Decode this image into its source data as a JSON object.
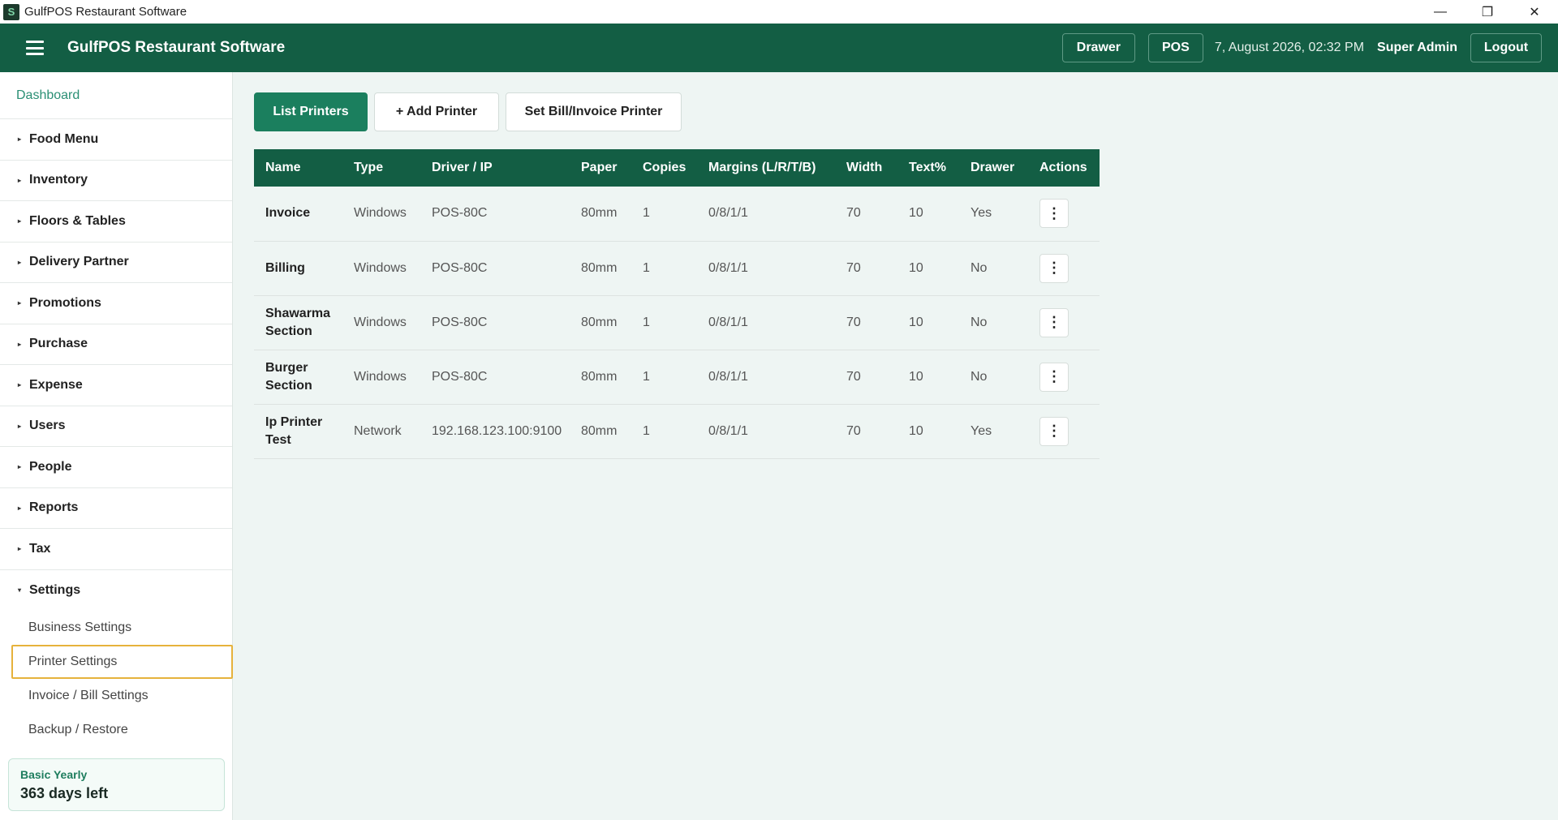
{
  "window": {
    "title": "GulfPOS Restaurant Software",
    "app_icon": "S",
    "controls": [
      "—",
      "❐",
      "✕"
    ]
  },
  "header": {
    "brand": "GulfPOS Restaurant Software",
    "drawer_label": "Drawer",
    "pos_label": "POS",
    "datetime": "7, August 2026, 02:32 PM",
    "user": "Super Admin",
    "logout_label": "Logout"
  },
  "sidebar": {
    "dashboard": "Dashboard",
    "items": [
      {
        "label": "Food Menu"
      },
      {
        "label": "Inventory"
      },
      {
        "label": "Floors & Tables"
      },
      {
        "label": "Delivery Partner"
      },
      {
        "label": "Promotions"
      },
      {
        "label": "Purchase"
      },
      {
        "label": "Expense"
      },
      {
        "label": "Users"
      },
      {
        "label": "People"
      },
      {
        "label": "Reports"
      },
      {
        "label": "Tax"
      },
      {
        "label": "Settings"
      }
    ],
    "settings_sub": [
      {
        "label": "Business Settings"
      },
      {
        "label": "Printer Settings"
      },
      {
        "label": "Invoice / Bill Settings"
      },
      {
        "label": "Backup / Restore"
      }
    ],
    "plan": {
      "name": "Basic Yearly",
      "days_left": "363 days left"
    }
  },
  "tabs": {
    "list": "List Printers",
    "add": "+ Add Printer",
    "set_bill": "Set Bill/Invoice Printer"
  },
  "table": {
    "headers": [
      "Name",
      "Type",
      "Driver / IP",
      "Paper",
      "Copies",
      "Margins (L/R/T/B)",
      "Width",
      "Text%",
      "Drawer",
      "Actions"
    ],
    "rows": [
      {
        "name": "Invoice",
        "type": "Windows",
        "driver": "POS-80C",
        "paper": "80mm",
        "copies": "1",
        "margins": "0/8/1/1",
        "width": "70",
        "text": "10",
        "drawer": "Yes"
      },
      {
        "name": "Billing",
        "type": "Windows",
        "driver": "POS-80C",
        "paper": "80mm",
        "copies": "1",
        "margins": "0/8/1/1",
        "width": "70",
        "text": "10",
        "drawer": "No"
      },
      {
        "name": "Shawarma Section",
        "type": "Windows",
        "driver": "POS-80C",
        "paper": "80mm",
        "copies": "1",
        "margins": "0/8/1/1",
        "width": "70",
        "text": "10",
        "drawer": "No"
      },
      {
        "name": "Burger Section",
        "type": "Windows",
        "driver": "POS-80C",
        "paper": "80mm",
        "copies": "1",
        "margins": "0/8/1/1",
        "width": "70",
        "text": "10",
        "drawer": "No"
      },
      {
        "name": "Ip Printer Test",
        "type": "Network",
        "driver": "192.168.123.100:9100",
        "paper": "80mm",
        "copies": "1",
        "margins": "0/8/1/1",
        "width": "70",
        "text": "10",
        "drawer": "Yes"
      }
    ],
    "action_icon": "⋮"
  },
  "colors": {
    "brand_green": "#135e44",
    "accent_green": "#1b7f5e",
    "active_outline": "#e6b23c"
  }
}
